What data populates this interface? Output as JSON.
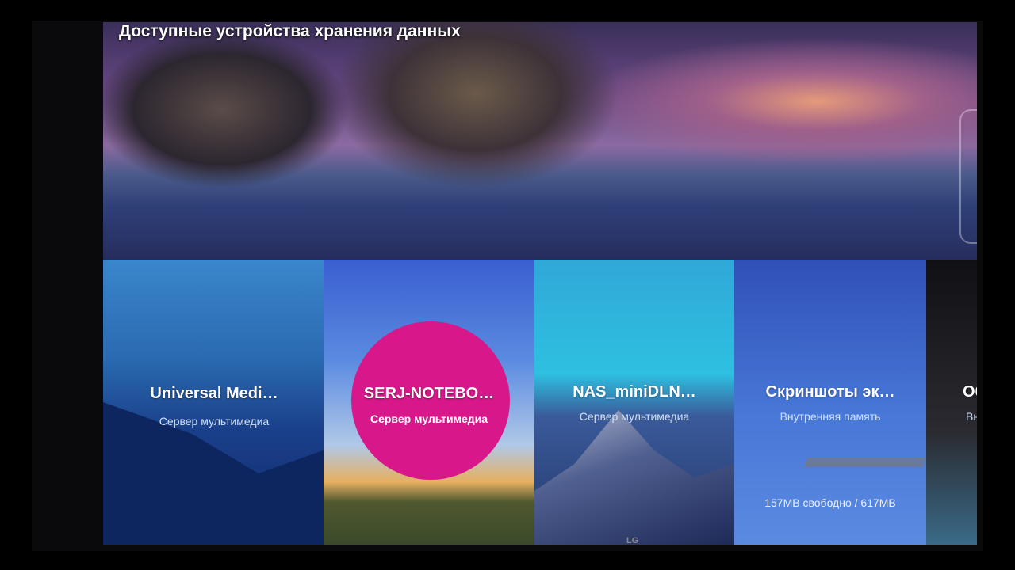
{
  "header": {
    "title": "Доступные устройства хранения данных"
  },
  "devices": [
    {
      "name": "Universal Medi…",
      "type": "Сервер мультимедиа"
    },
    {
      "name": "SERJ-NOTEBO…",
      "type": "Сервер мультимедиа"
    },
    {
      "name": "NAS_miniDLN…",
      "type": "Сервер мультимедиа"
    },
    {
      "name": "Скриншоты эк…",
      "type": "Внутренняя память",
      "storage": "157MB свободно / 617MB"
    },
    {
      "name": "Об",
      "type": "Вн"
    }
  ],
  "tv": {
    "brand": "LG"
  },
  "colors": {
    "focus": "#d8188a"
  }
}
